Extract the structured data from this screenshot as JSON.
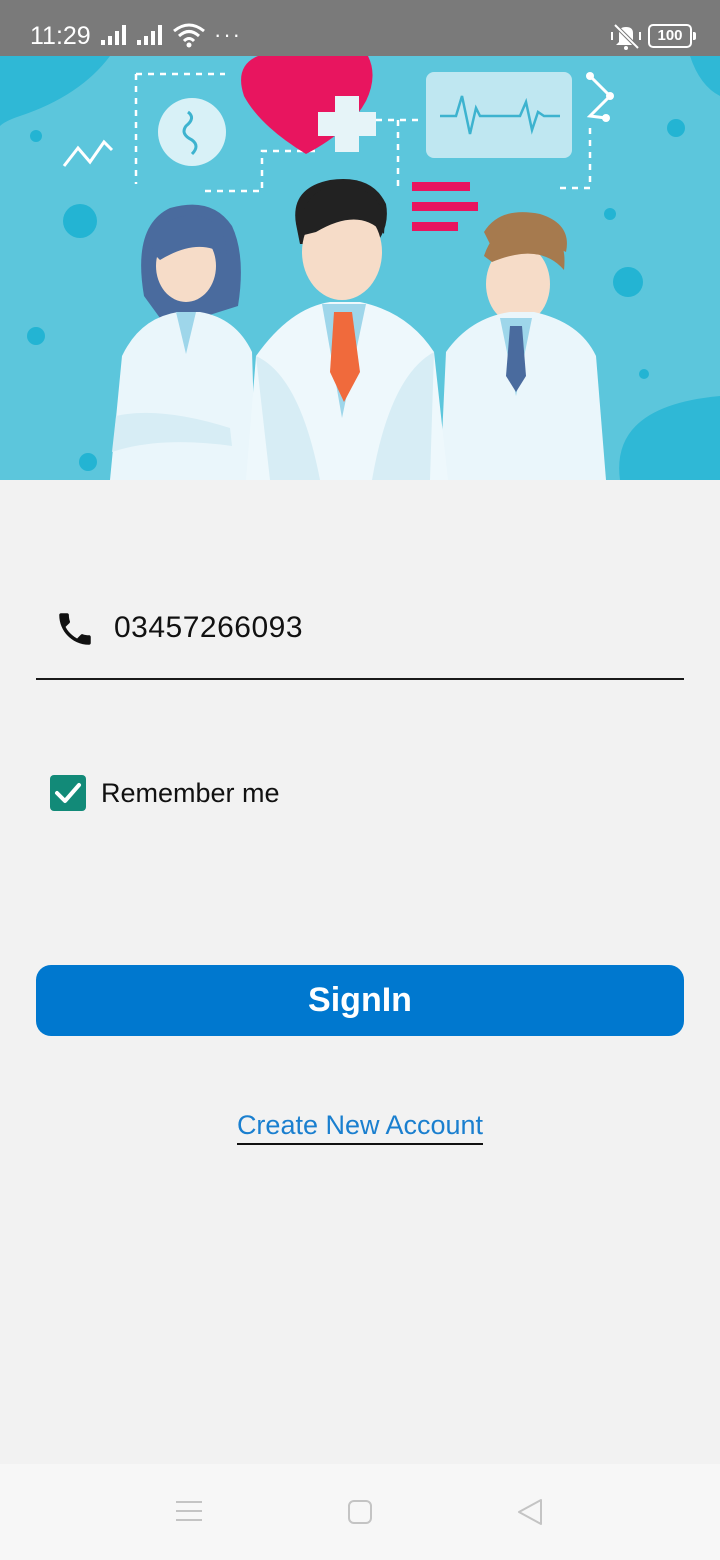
{
  "status_bar": {
    "time": "11:29",
    "overflow": "···",
    "battery": "100",
    "icons": [
      "signal-icon",
      "signal-icon",
      "wifi-icon",
      "mute-vibrate-icon",
      "battery-icon"
    ]
  },
  "hero": {
    "description_icon": "doctors-illustration",
    "colors": {
      "background": "#5cc6dc",
      "accent": "#e8155f"
    }
  },
  "login": {
    "phone_value": "03457266093",
    "phone_icon": "phone-icon",
    "remember_label": "Remember me",
    "remember_checked": true,
    "signin_label": "SignIn",
    "create_account_label": "Create New Account"
  },
  "colors": {
    "primary": "#0078cf",
    "checkbox": "#128a78",
    "link": "#1a7fcf",
    "page_background": "#f2f2f2"
  },
  "nav_bar": {
    "icons": [
      "menu-icon",
      "home-square-icon",
      "back-triangle-icon"
    ]
  }
}
